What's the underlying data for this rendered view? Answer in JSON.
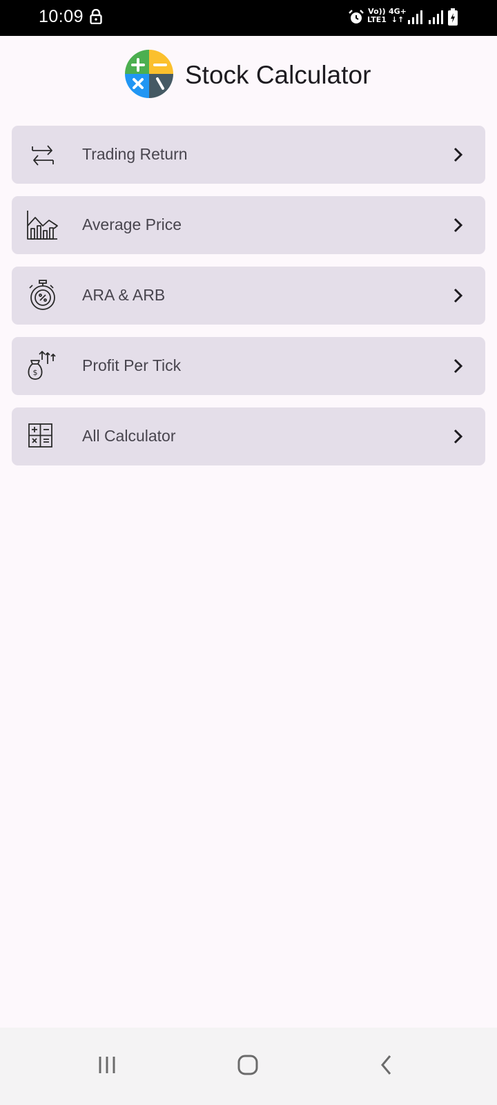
{
  "status_bar": {
    "time": "10:09",
    "volte_line1": "Vo))",
    "volte_line2": "LTE1",
    "net_line1": "4G+",
    "net_line2": "↓↑",
    "icons": [
      "lock-icon",
      "alarm-icon",
      "signal-icon",
      "signal-icon",
      "battery-charging-icon"
    ]
  },
  "header": {
    "title": "Stock Calculator",
    "logo_icon": "calculator-logo-icon",
    "logo_colors": {
      "top_left": "#4caf50",
      "top_right": "#fbc02d",
      "bottom_left": "#2196f3",
      "bottom_right": "#455a64"
    }
  },
  "menu": {
    "items": [
      {
        "label": "Trading Return",
        "icon": "arrows-exchange-icon"
      },
      {
        "label": "Average Price",
        "icon": "bar-chart-trend-icon"
      },
      {
        "label": "ARA & ARB",
        "icon": "stopwatch-percent-icon"
      },
      {
        "label": "Profit Per Tick",
        "icon": "money-bag-arrows-icon"
      },
      {
        "label": "All Calculator",
        "icon": "calculator-grid-icon"
      }
    ],
    "chevron_icon": "chevron-right-icon"
  },
  "nav_bar": {
    "icons": [
      "recents-icon",
      "home-icon",
      "back-icon"
    ]
  },
  "colors": {
    "background": "#fdf8fc",
    "card": "#e4dee9",
    "label": "#48454e",
    "title": "#1d1b20"
  }
}
